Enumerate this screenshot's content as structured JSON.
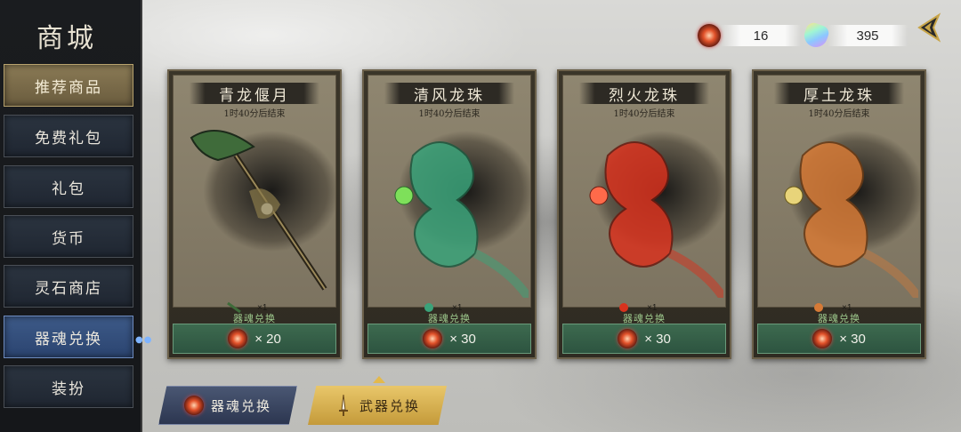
{
  "sidebar": {
    "title": "商城",
    "items": [
      {
        "label": "推荐商品",
        "state": "highlight"
      },
      {
        "label": "免费礼包",
        "state": "normal"
      },
      {
        "label": "礼包",
        "state": "normal"
      },
      {
        "label": "货币",
        "state": "normal"
      },
      {
        "label": "灵石商店",
        "state": "normal"
      },
      {
        "label": "器魂兑换",
        "state": "active"
      },
      {
        "label": "装扮",
        "state": "normal"
      }
    ]
  },
  "currency": {
    "soul_coin": {
      "icon": "soul-coin-icon",
      "value": "16"
    },
    "crystal": {
      "icon": "crystal-icon",
      "value": "395"
    }
  },
  "cards": [
    {
      "title": "青龙偃月",
      "timer": "1时40分后结束",
      "item_qty": "×1",
      "exchange_label": "器魂兑换",
      "price": "× 20",
      "color": "#3f6b3a",
      "art_icon": "blade-icon"
    },
    {
      "title": "清风龙珠",
      "timer": "1时40分后结束",
      "item_qty": "×1",
      "exchange_label": "器魂兑换",
      "price": "× 30",
      "color": "#3aa37a",
      "art_icon": "dragon-orb-icon"
    },
    {
      "title": "烈火龙珠",
      "timer": "1时40分后结束",
      "item_qty": "×1",
      "exchange_label": "器魂兑换",
      "price": "× 30",
      "color": "#d8321e",
      "art_icon": "dragon-orb-icon"
    },
    {
      "title": "厚土龙珠",
      "timer": "1时40分后结束",
      "item_qty": "×1",
      "exchange_label": "器魂兑换",
      "price": "× 30",
      "color": "#d67a36",
      "art_icon": "dragon-orb-icon"
    }
  ],
  "tabs": {
    "soul_exchange": "器魂兑换",
    "weapon_exchange": "武器兑换"
  }
}
